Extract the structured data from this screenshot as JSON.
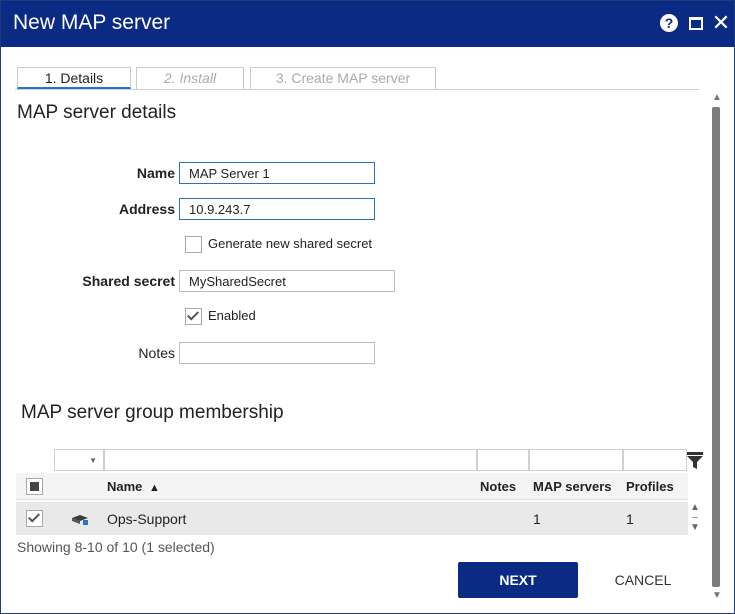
{
  "window": {
    "title": "New MAP server"
  },
  "tabs": [
    {
      "label": "1. Details"
    },
    {
      "label": "2. Install"
    },
    {
      "label": "3. Create MAP server"
    }
  ],
  "details": {
    "section_title": "MAP server details",
    "name_label": "Name",
    "name_value": "MAP Server 1",
    "address_label": "Address",
    "address_value": "10.9.243.7",
    "generate_secret_label": "Generate new shared secret",
    "generate_secret_checked": false,
    "shared_secret_label": "Shared secret",
    "shared_secret_value": "MySharedSecret",
    "enabled_label": "Enabled",
    "enabled_checked": true,
    "notes_label": "Notes",
    "notes_value": ""
  },
  "membership": {
    "section_title": "MAP server group membership",
    "columns": [
      "Name",
      "Notes",
      "MAP servers",
      "Profiles"
    ],
    "sort_indicator": "▲",
    "rows": [
      {
        "checked": true,
        "name": "Ops-Support",
        "notes": "",
        "map_servers": "1",
        "profiles": "1"
      }
    ],
    "status": "Showing 8-10 of 10 (1 selected)"
  },
  "buttons": {
    "next": "NEXT",
    "cancel": "CANCEL"
  },
  "icons": {
    "help": "help-icon",
    "maximize": "maximize-icon",
    "close": "close-icon",
    "filter": "filter-icon",
    "server_group": "server-group-icon"
  },
  "colors": {
    "titlebar": "#0a2a84",
    "primary_button": "#0a2a84",
    "tab_underline": "#2b72c9"
  }
}
